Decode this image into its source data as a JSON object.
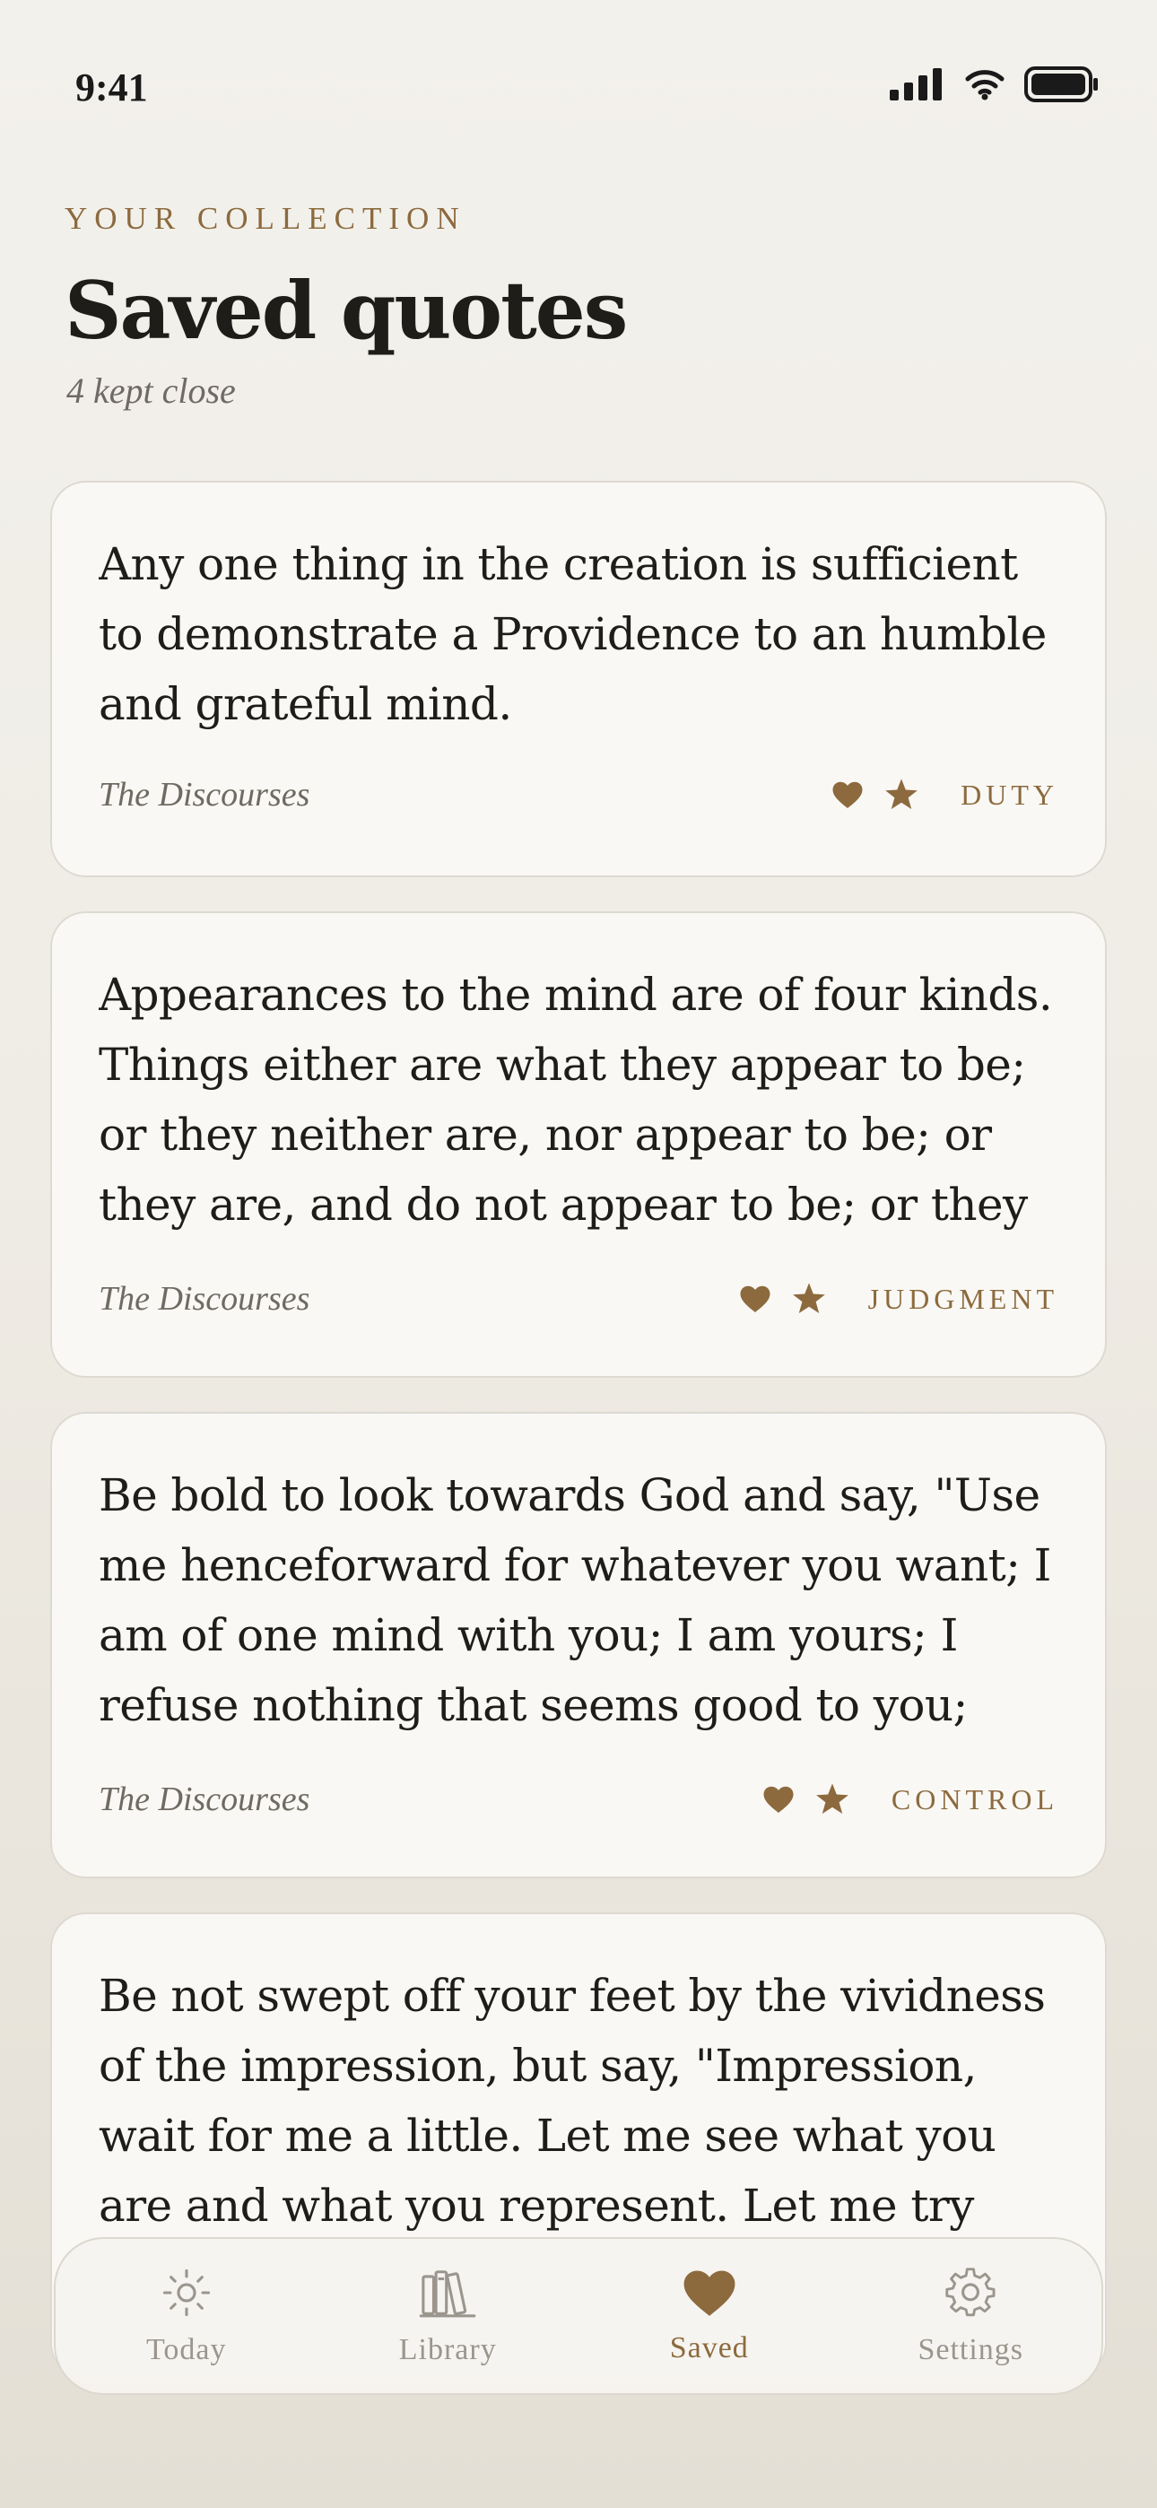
{
  "status_bar": {
    "time": "9:41",
    "icons": [
      "cellular-signal-icon",
      "wifi-icon",
      "battery-icon"
    ]
  },
  "header": {
    "eyebrow": "YOUR COLLECTION",
    "title": "Saved quotes",
    "subtitle": "4 kept close"
  },
  "quotes": [
    {
      "text": "Any one thing in the creation is sufficient to demonstrate a Providence to an humble and grateful mind.",
      "source": "The Discourses",
      "tag": "DUTY"
    },
    {
      "text": "Appearances to the mind are of four kinds. Things either are what they appear to be; or they neither are, nor appear to be; or they are, and do not appear to be; or they are",
      "source": "The Discourses",
      "tag": "JUDGMENT"
    },
    {
      "text": "Be bold to look towards God and say, \"Use me henceforward for whatever you want; I am of one mind with you; I am yours; I refuse nothing that seems good to you; lead",
      "source": "The Discourses",
      "tag": "CONTROL"
    },
    {
      "text": "Be not swept off your feet by the vividness of the impression, but say, \"Impression, wait for me a little. Let me see what you are and what you represent. Let me try you.\"",
      "source": "",
      "tag": ""
    }
  ],
  "tab_bar": {
    "tabs": [
      {
        "label": "Today",
        "icon": "sun-icon"
      },
      {
        "label": "Library",
        "icon": "books-icon"
      },
      {
        "label": "Saved",
        "icon": "heart-icon"
      },
      {
        "label": "Settings",
        "icon": "gear-icon"
      }
    ],
    "active": "Saved"
  },
  "colors": {
    "accent": "#8c6a3e",
    "background": "#f1eee8",
    "card": "#f9f8f4",
    "text": "#1f1d1a",
    "muted": "#6f6a62",
    "tab_inactive": "#9a958d"
  }
}
